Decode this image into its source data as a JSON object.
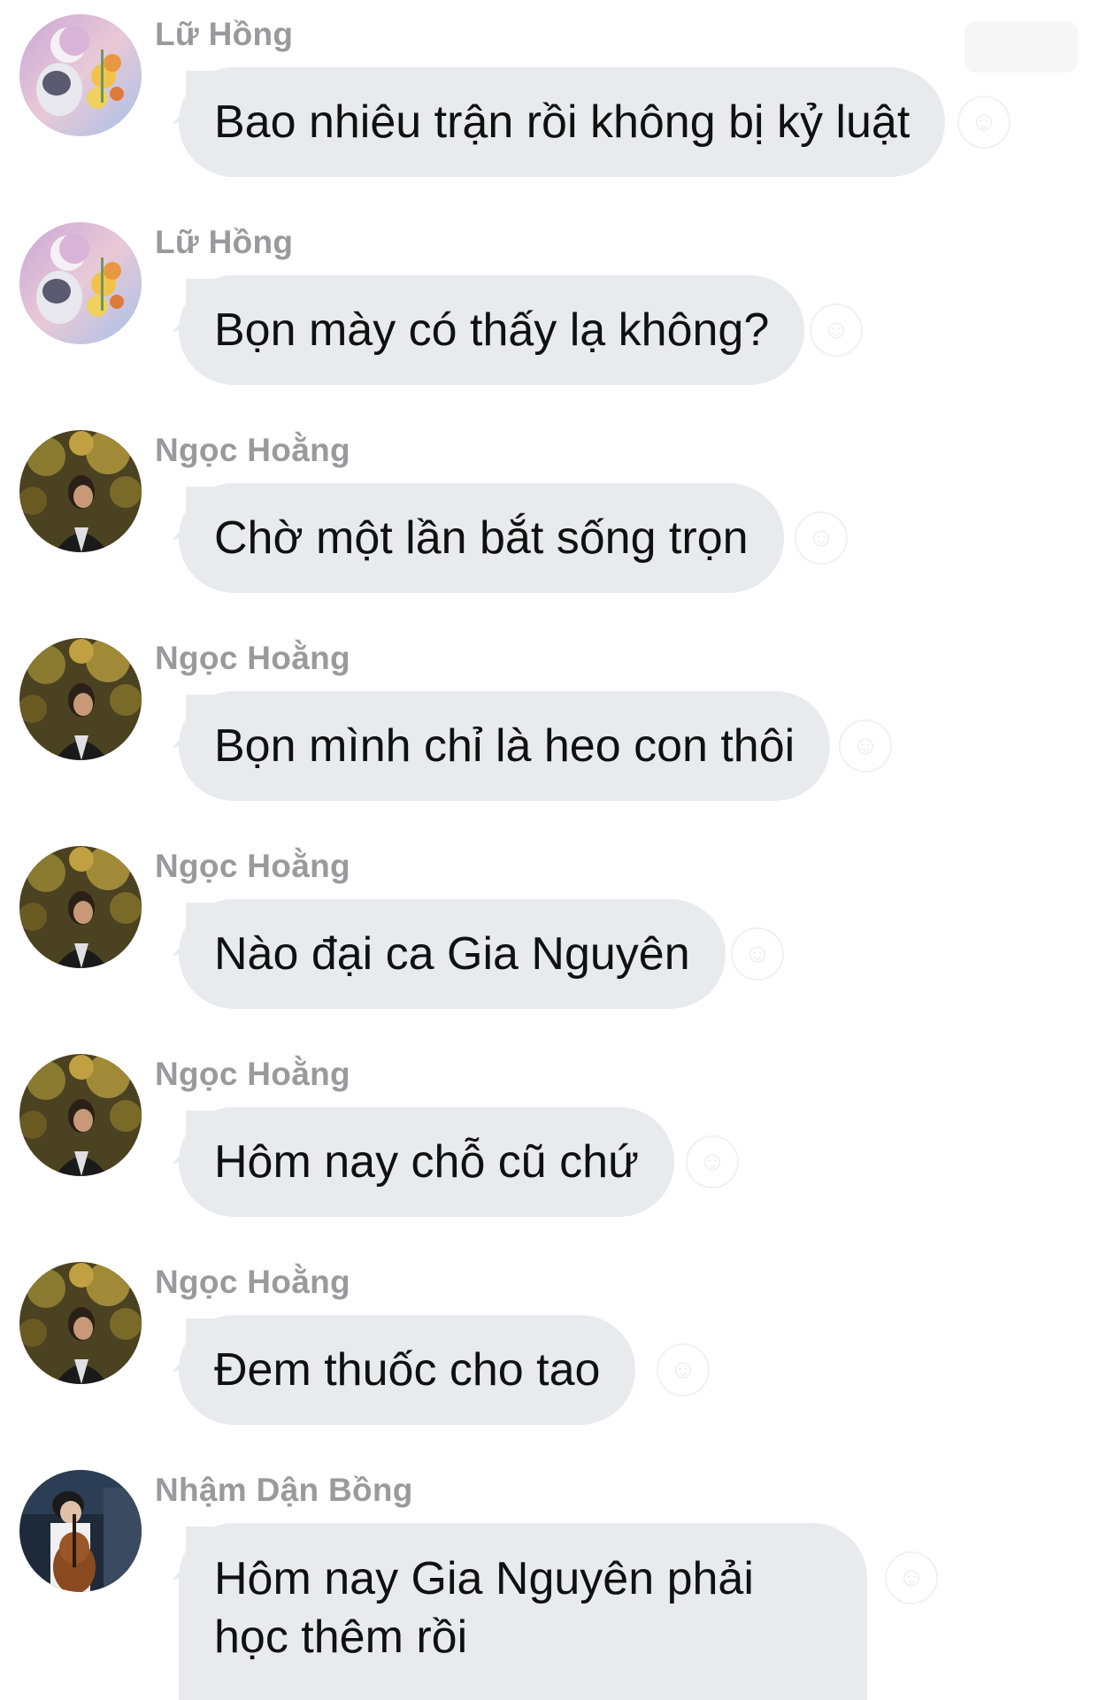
{
  "messages": [
    {
      "sender": "Lữ Hồng",
      "text": "Bao nhiêu trận rồi không bị kỷ luật",
      "avatar": "astronaut-flowers"
    },
    {
      "sender": "Lữ Hồng",
      "text": "Bọn mày có thấy lạ không?",
      "avatar": "astronaut-flowers"
    },
    {
      "sender": "Ngọc Hoằng",
      "text": "Chờ một lần bắt sống trọn",
      "avatar": "person-under-tree"
    },
    {
      "sender": "Ngọc Hoằng",
      "text": "Bọn mình chỉ là heo con thôi",
      "avatar": "person-under-tree"
    },
    {
      "sender": "Ngọc Hoằng",
      "text": "Nào đại ca Gia Nguyên",
      "avatar": "person-under-tree"
    },
    {
      "sender": "Ngọc Hoằng",
      "text": "Hôm nay chỗ cũ chứ",
      "avatar": "person-under-tree"
    },
    {
      "sender": "Ngọc Hoằng",
      "text": "Đem thuốc cho tao",
      "avatar": "person-under-tree"
    },
    {
      "sender": "Nhậm Dận Bồng",
      "text": "Hôm nay Gia Nguyên phải học thêm rồi",
      "avatar": "person-with-cello"
    }
  ],
  "icons": {
    "reaction": "smiley-icon",
    "top_badge": "follow-badge"
  },
  "colors": {
    "bubble": "#e9eaed",
    "sender": "#9a9a9e",
    "text": "#101010",
    "background": "#ffffff"
  }
}
